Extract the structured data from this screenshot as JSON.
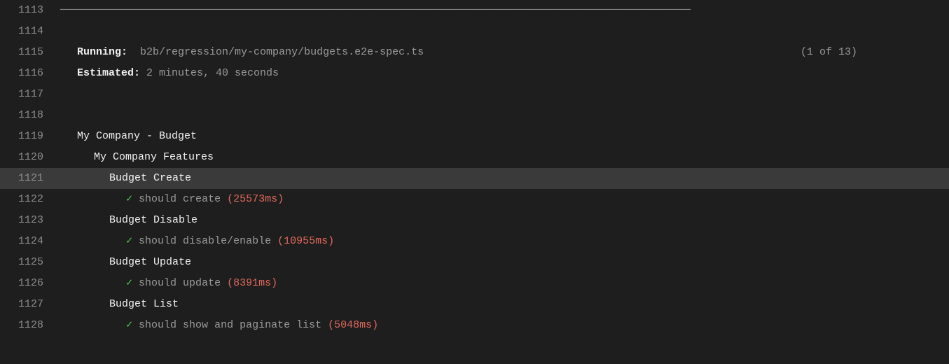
{
  "startLine": 1113,
  "highlightedLine": 1121,
  "ruleChar": "─",
  "running": {
    "label": "Running:",
    "spec": "b2b/regression/my-company/budgets.e2e-spec.ts",
    "count": "(1 of 13)"
  },
  "estimated": {
    "label": "Estimated:",
    "value": "2 minutes, 40 seconds"
  },
  "suite": {
    "title": "My Company - Budget",
    "feature": "My Company Features",
    "groups": [
      {
        "name": "Budget Create",
        "tests": [
          {
            "check": "✓",
            "desc": "should create",
            "timing": "(25573ms)"
          }
        ]
      },
      {
        "name": "Budget Disable",
        "tests": [
          {
            "check": "✓",
            "desc": "should disable/enable",
            "timing": "(10955ms)"
          }
        ]
      },
      {
        "name": "Budget Update",
        "tests": [
          {
            "check": "✓",
            "desc": "should update",
            "timing": "(8391ms)"
          }
        ]
      },
      {
        "name": "Budget List",
        "tests": [
          {
            "check": "✓",
            "desc": "should show and paginate list",
            "timing": "(5048ms)"
          }
        ]
      }
    ]
  }
}
